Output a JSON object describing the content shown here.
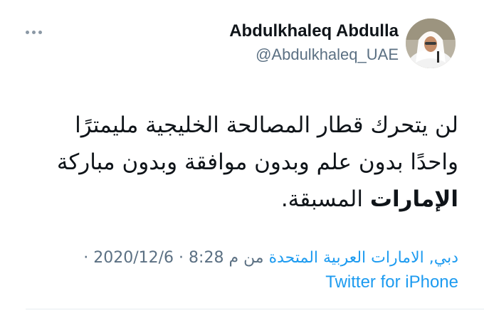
{
  "author": {
    "display_name": "Abdulkhaleq Abdulla",
    "handle": "@Abdulkhaleq_UAE",
    "avatar_icon": "profile-photo"
  },
  "more_icon": "more-dots-icon",
  "tweet": {
    "line1": "لن يتحرك قطار المصالحة الخليجية مليمترًا",
    "line2": "واحدًا بدون علم وبدون موافقة وبدون مباركة",
    "line3_bold": "الإمارات",
    "line3_rest": " المسبقة."
  },
  "meta": {
    "time": "8:28 م",
    "separator": "·",
    "date": "2020/12/6",
    "from": "من",
    "location": "دبي, الامارات العربية المتحدة",
    "source": "Twitter for iPhone"
  },
  "colors": {
    "link": "#1d9bf0",
    "secondary_text": "#5b7083",
    "primary_text": "#0f1419"
  }
}
